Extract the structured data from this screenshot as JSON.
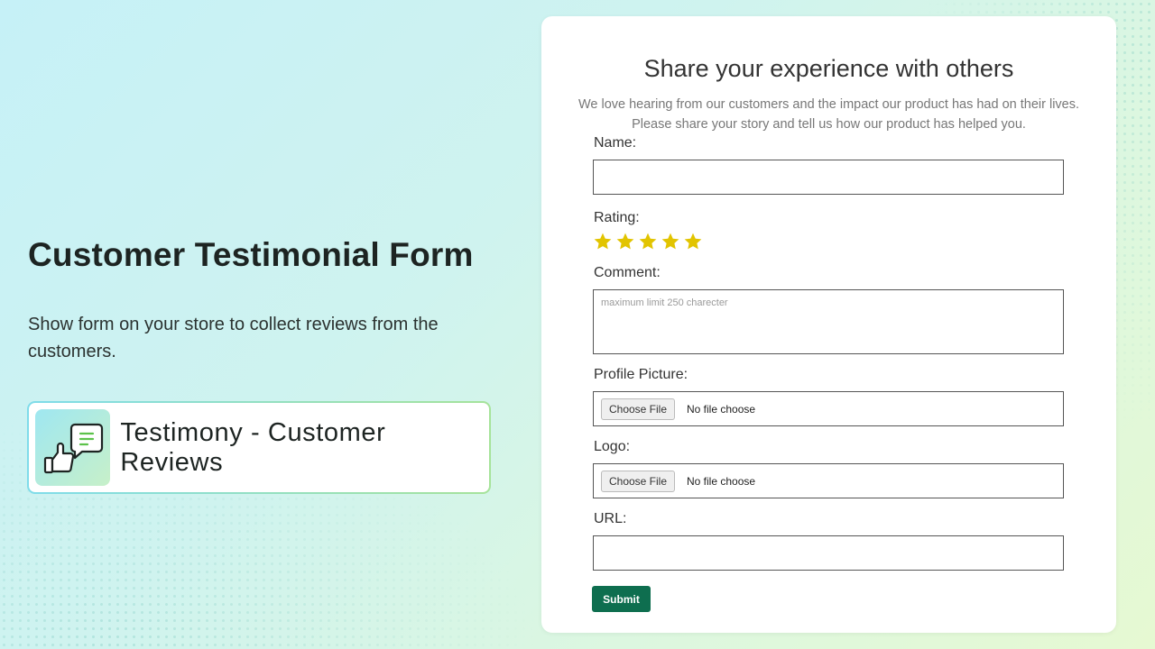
{
  "hero": {
    "title": "Customer Testimonial Form",
    "description": "Show form on your store to collect reviews from the customers."
  },
  "app": {
    "name": "Testimony - Customer Reviews",
    "icon": "thumbs-up-chat-icon"
  },
  "form": {
    "title": "Share your experience with others",
    "subtitle_line1": "We love hearing from our customers and the impact our product has had on their lives.",
    "subtitle_line2": "Please share your story and tell us how our product has helped you.",
    "name": {
      "label": "Name:",
      "value": ""
    },
    "rating": {
      "label": "Rating:",
      "value": 5,
      "max": 5,
      "star_color": "#e2c400"
    },
    "comment": {
      "label": "Comment:",
      "placeholder": "maximum limit 250 charecter",
      "value": ""
    },
    "profile_picture": {
      "label": "Profile Picture:",
      "button": "Choose File",
      "status": "No file choose"
    },
    "logo": {
      "label": "Logo:",
      "button": "Choose File",
      "status": "No file choose"
    },
    "url": {
      "label": "URL:",
      "value": ""
    },
    "submit": "Submit"
  },
  "colors": {
    "submit_bg": "#0e6e4f",
    "title_text": "#1d2422"
  }
}
